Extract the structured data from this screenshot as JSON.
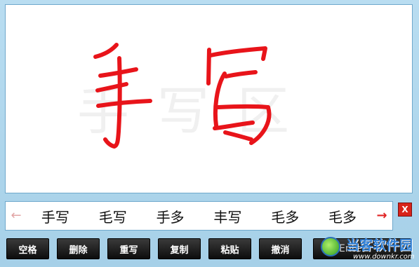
{
  "pad": {
    "watermark": "手写区",
    "ink_color": "#e8141a"
  },
  "candidates": {
    "prev_arrow": "←",
    "next_arrow": "→",
    "items": [
      "手写",
      "毛写",
      "手多",
      "丰写",
      "毛多",
      "毛多"
    ]
  },
  "close": {
    "label": "X"
  },
  "buttons": {
    "space": "空格",
    "delete": "删除",
    "rewrite": "重写",
    "copy": "复制",
    "paste": "粘贴",
    "undo": "撤消",
    "enter": "Enter",
    "enter_icon": "⮐"
  },
  "site": {
    "name": "当客软件园",
    "url": "www.downkr.com"
  }
}
